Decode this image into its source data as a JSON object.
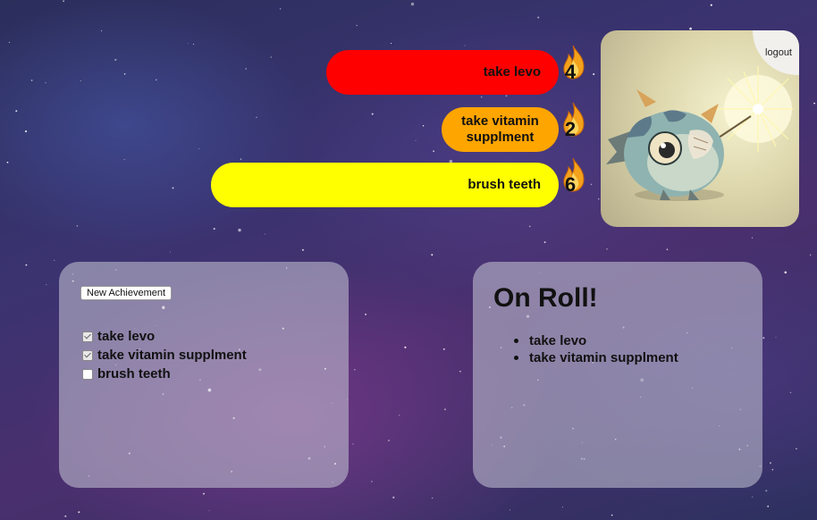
{
  "habits": [
    {
      "label": "take levo",
      "streak": "4",
      "color": "#ff0000"
    },
    {
      "label": "take vitamin supplment",
      "streak": "2",
      "color": "#ffa500"
    },
    {
      "label": "brush teeth",
      "streak": "6",
      "color": "#ffff00"
    }
  ],
  "profile": {
    "logout_label": "logout",
    "avatar_image": "baby dragon holding sparkler"
  },
  "achievements": {
    "new_button_label": "New Achievement",
    "items": [
      {
        "label": "take levo",
        "checked": true
      },
      {
        "label": "take vitamin supplment",
        "checked": true
      },
      {
        "label": "brush teeth",
        "checked": false
      }
    ]
  },
  "on_roll": {
    "title": "On Roll!",
    "items": [
      "take levo",
      "take vitamin supplment"
    ]
  },
  "icons": {
    "streak": "flame-icon",
    "bullet": "bullet-icon"
  }
}
